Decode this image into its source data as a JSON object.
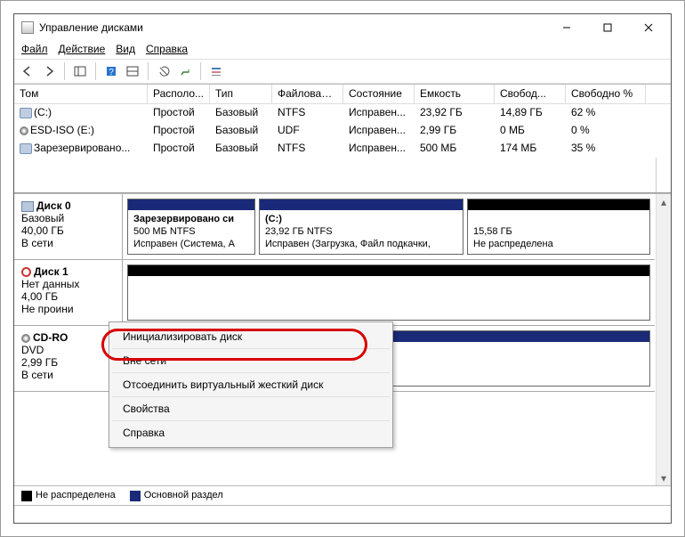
{
  "window": {
    "title": "Управление дисками"
  },
  "menu": {
    "file": "Файл",
    "action": "Действие",
    "view": "Вид",
    "help": "Справка"
  },
  "columns": [
    "Том",
    "Располо...",
    "Тип",
    "Файловая с...",
    "Состояние",
    "Емкость",
    "Свобод...",
    "Свободно %"
  ],
  "volumes": [
    {
      "icon": "disk",
      "name": "(C:)",
      "layout": "Простой",
      "type": "Базовый",
      "fs": "NTFS",
      "status": "Исправен...",
      "capacity": "23,92 ГБ",
      "free": "14,89 ГБ",
      "pct": "62 %"
    },
    {
      "icon": "cd",
      "name": "ESD-ISO (E:)",
      "layout": "Простой",
      "type": "Базовый",
      "fs": "UDF",
      "status": "Исправен...",
      "capacity": "2,99 ГБ",
      "free": "0 МБ",
      "pct": "0 %"
    },
    {
      "icon": "disk",
      "name": "Зарезервировано...",
      "layout": "Простой",
      "type": "Базовый",
      "fs": "NTFS",
      "status": "Исправен...",
      "capacity": "500 МБ",
      "free": "174 МБ",
      "pct": "35 %"
    }
  ],
  "disks": [
    {
      "icon": "disk",
      "title": "Диск 0",
      "l1": "Базовый",
      "l2": "40,00 ГБ",
      "l3": "В сети",
      "parts": [
        {
          "stripe": "primary",
          "t1": "Зарезервировано си",
          "t2": "500 МБ NTFS",
          "t3": "Исправен (Система, А"
        },
        {
          "stripe": "primary",
          "t1": "(C:)",
          "t2": "23,92 ГБ NTFS",
          "t3": "Исправен (Загрузка, Файл подкачки,"
        },
        {
          "stripe": "unalloc",
          "t1": "",
          "t2": "15,58 ГБ",
          "t3": "Не распределена"
        }
      ]
    },
    {
      "icon": "warn",
      "title": "Диск 1",
      "l1": "Нет данных",
      "l2": "4,00 ГБ",
      "l3": "Не проини",
      "parts": [
        {
          "stripe": "unalloc",
          "t1": "",
          "t2": "",
          "t3": ""
        }
      ]
    },
    {
      "icon": "cd",
      "title": "CD-RO",
      "l1": "DVD",
      "l2": "2,99 ГБ",
      "l3": "В сети",
      "parts": [
        {
          "stripe": "primary",
          "t1": "",
          "t2": "",
          "t3": ""
        }
      ]
    }
  ],
  "legend": {
    "unalloc": "Не распределена",
    "primary": "Основной раздел"
  },
  "context_menu": [
    "Инициализировать диск",
    "Вне сети",
    "Отсоединить виртуальный жесткий диск",
    "Свойства",
    "Справка"
  ]
}
